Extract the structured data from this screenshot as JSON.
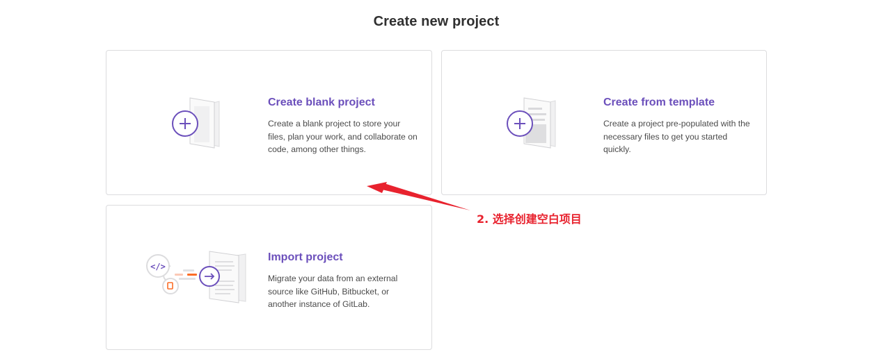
{
  "page": {
    "title": "Create new project"
  },
  "cards": {
    "blank": {
      "heading": "Create blank project",
      "description": "Create a blank project to store your files, plan your work, and collaborate on code, among other things.",
      "icon": "blank-project-icon"
    },
    "template": {
      "heading": "Create from template",
      "description": "Create a project pre-populated with the necessary files to get you started quickly.",
      "icon": "template-project-icon"
    },
    "import": {
      "heading": "Import project",
      "description": "Migrate your data from an external source like GitHub, Bitbucket, or another instance of GitLab.",
      "icon": "import-project-icon"
    }
  },
  "annotation": {
    "label": "2. 选择创建空白项目",
    "color": "#e8222e"
  },
  "colors": {
    "accent": "#6b4fbb",
    "border": "#dcdcde",
    "annotation": "#e8222e"
  }
}
